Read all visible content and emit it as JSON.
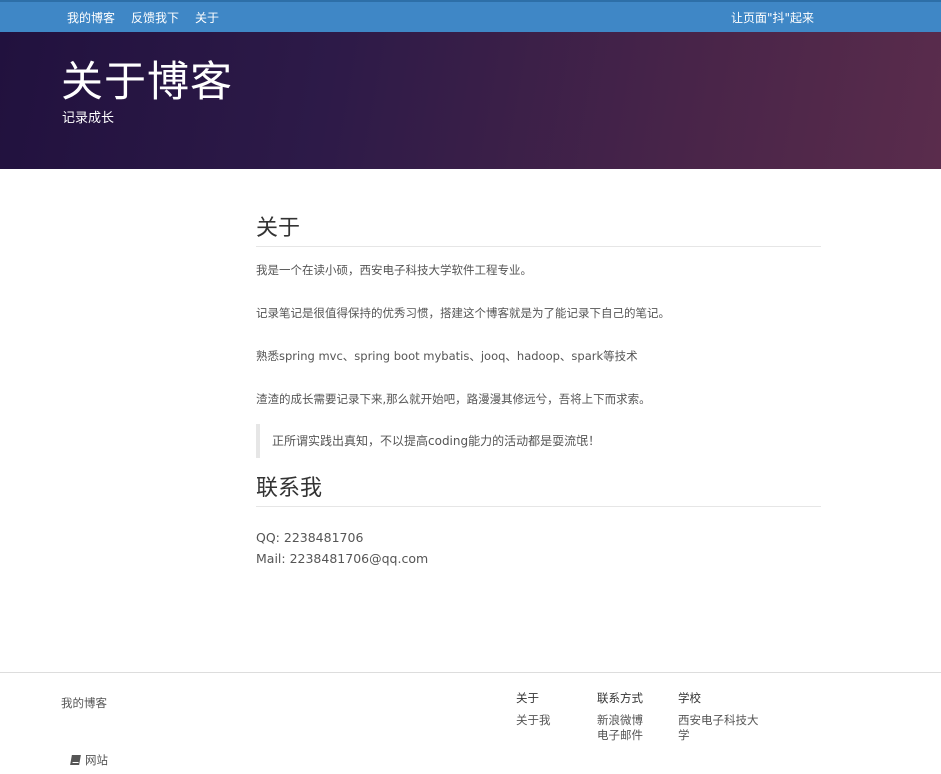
{
  "navbar": {
    "links": [
      "我的博客",
      "反馈我下",
      "关于"
    ],
    "right_text": "让页面\"抖\"起来"
  },
  "header": {
    "title": "关于博客",
    "subtitle": "记录成长"
  },
  "about": {
    "title": "关于",
    "paragraphs": [
      "我是一个在读小硕，西安电子科技大学软件工程专业。",
      "记录笔记是很值得保持的优秀习惯，搭建这个博客就是为了能记录下自己的笔记。",
      "熟悉spring mvc、spring boot mybatis、jooq、hadoop、spark等技术",
      "渣渣的成长需要记录下来,那么就开始吧，路漫漫其修远兮，吾将上下而求索。"
    ],
    "quote": "正所谓实践出真知，不以提高coding能力的活动都是耍流氓！"
  },
  "contact": {
    "title": "联系我",
    "qq": "QQ: 2238481706",
    "mail": "Mail: 2238481706@qq.com"
  },
  "footer": {
    "brand": "我的博客",
    "columns": [
      {
        "heading": "关于",
        "items": [
          "关于我"
        ]
      },
      {
        "heading": "联系方式",
        "items": [
          "新浪微博",
          "电子邮件"
        ]
      },
      {
        "heading": "学校",
        "items": [
          "西安电子科技大学"
        ]
      }
    ],
    "site_label": "网站",
    "site_icon": "book-icon"
  }
}
